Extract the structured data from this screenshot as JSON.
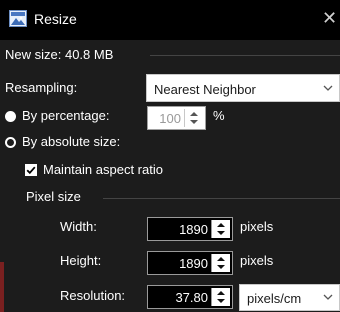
{
  "window": {
    "title": "Resize",
    "close_glyph": "✕"
  },
  "new_size_label": "New size: 40.8 MB",
  "resampling": {
    "label": "Resampling:",
    "value": "Nearest Neighbor"
  },
  "by_percentage": {
    "label": "By percentage:",
    "value": "100",
    "unit": "%",
    "selected": true
  },
  "by_absolute": {
    "label": "By absolute size:",
    "selected": false
  },
  "maintain_aspect": {
    "label": "Maintain aspect ratio",
    "checked": true
  },
  "pixel_size": {
    "heading": "Pixel size",
    "width": {
      "label": "Width:",
      "value": "1890",
      "unit": "pixels"
    },
    "height": {
      "label": "Height:",
      "value": "1890",
      "unit": "pixels"
    },
    "resolution": {
      "label": "Resolution:",
      "value": "37.80",
      "unit": "pixels/cm"
    }
  }
}
